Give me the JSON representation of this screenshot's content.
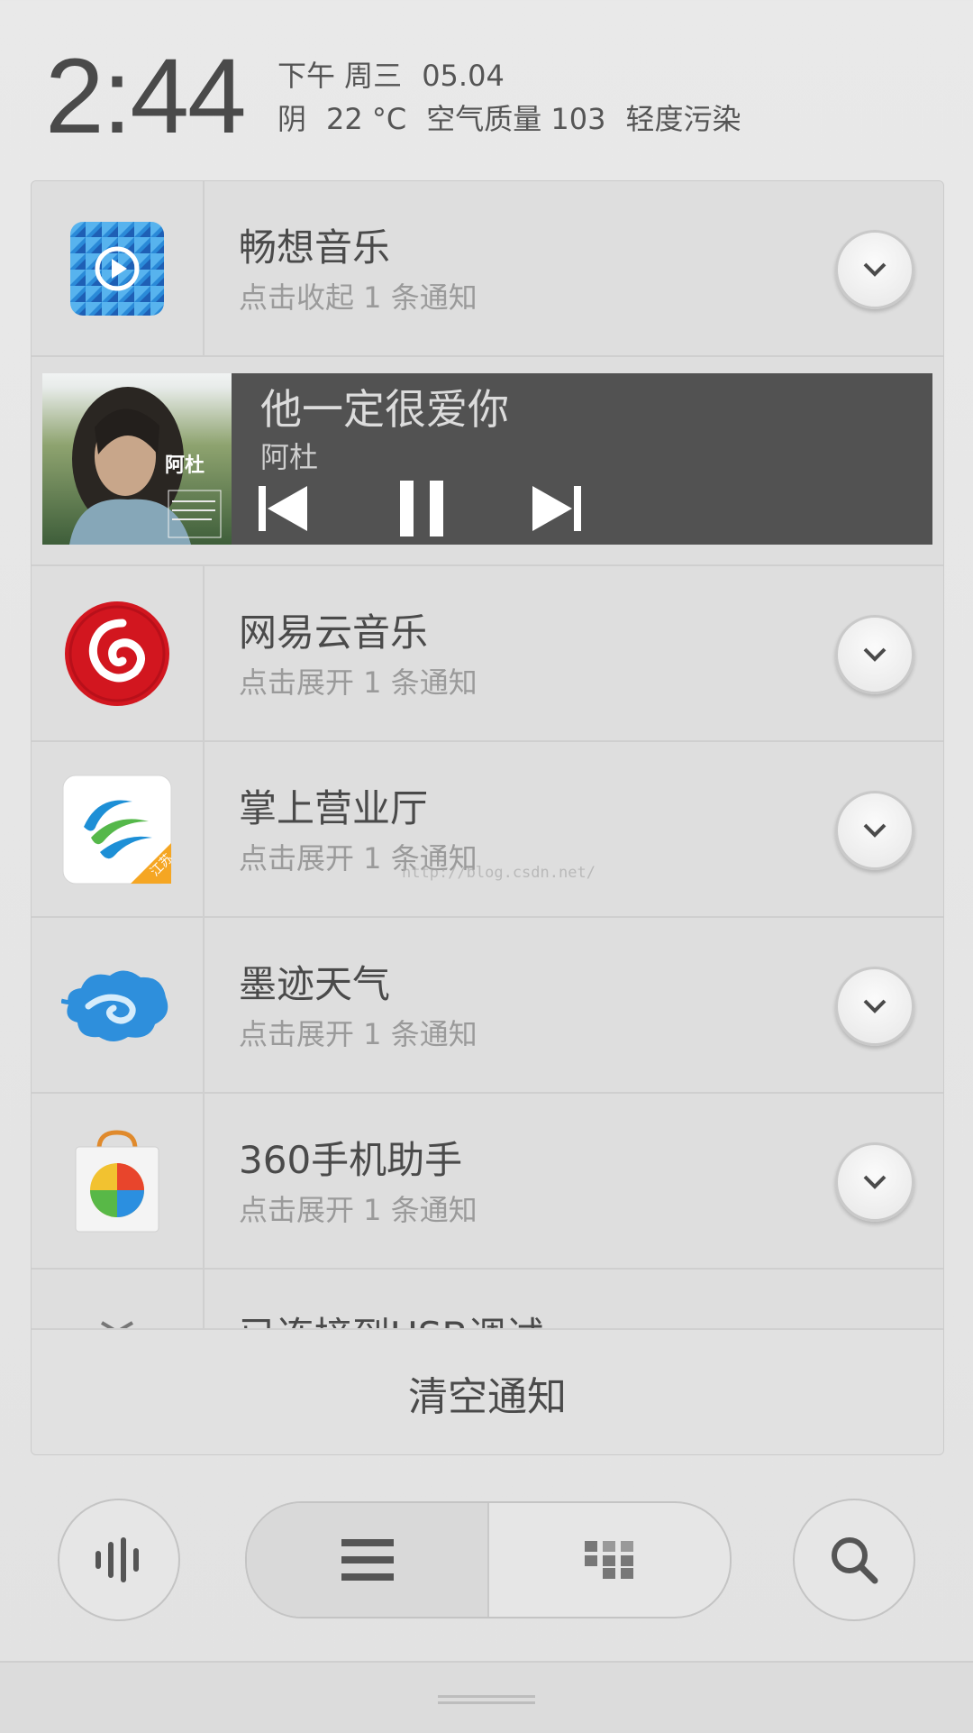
{
  "status": {
    "time": "2:44",
    "period_day": "下午 周三",
    "date": "05.04",
    "weather": "阴",
    "temperature": "22 °C",
    "air_quality": "空气质量 103",
    "pollution": "轻度污染"
  },
  "media": {
    "song": "他一定很爱你",
    "artist": "阿杜",
    "album_text": "阿杜"
  },
  "notifications": [
    {
      "app": "畅想音乐",
      "action": "点击收起 1 条通知"
    },
    {
      "app": "网易云音乐",
      "action": "点击展开 1 条通知"
    },
    {
      "app": "掌上营业厅",
      "action": "点击展开 1 条通知",
      "badge": "江苏"
    },
    {
      "app": "墨迹天气",
      "action": "点击展开 1 条通知"
    },
    {
      "app": "360手机助手",
      "action": "点击展开 1 条通知"
    },
    {
      "app": "已连接到USB调试",
      "action": ""
    }
  ],
  "clear_label": "清空通知",
  "watermark": "http://blog.csdn.net/",
  "colors": {
    "accent_netease": "#d2161f",
    "media_bg": "#525252"
  }
}
